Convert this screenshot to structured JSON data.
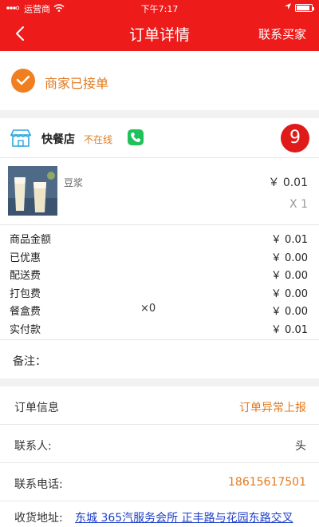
{
  "status_bar": {
    "carrier": "运营商",
    "time": "下午7:17",
    "battery_level": 0.9
  },
  "navbar": {
    "back_icon": "chevron-left-icon",
    "title": "订单详情",
    "contact_label": "联系买家"
  },
  "order_status": {
    "text": "商家已接单",
    "icon": "check-circle-icon",
    "color": "#f0801f"
  },
  "shop": {
    "name": "快餐店",
    "status": "不在线",
    "badge_count": "9"
  },
  "product": {
    "name": "豆浆",
    "price": "￥ 0.01",
    "quantity": "X 1"
  },
  "fees": [
    {
      "label": "商品金额",
      "mid": "",
      "value": "￥ 0.01"
    },
    {
      "label": "已优惠",
      "mid": "",
      "value": "￥ 0.00"
    },
    {
      "label": "配送费",
      "mid": "",
      "value": "￥ 0.00"
    },
    {
      "label": "打包费",
      "mid": "",
      "value": "￥ 0.00"
    },
    {
      "label": "餐盒费",
      "mid": "×0",
      "value": "￥ 0.00"
    },
    {
      "label": "实付款",
      "mid": "",
      "value": "￥ 0.01"
    }
  ],
  "remark": {
    "label": "备注："
  },
  "order_info": {
    "label": "订单信息",
    "report_link": "订单异常上报",
    "contact_label": "联系人:",
    "contact_value": "头",
    "phone_label": "联系电话:",
    "phone_value": "18615617501",
    "address_label": "收货地址:",
    "address_value": "东城 365汽服务会所 正丰路与花园东路交叉"
  },
  "colors": {
    "brand_red": "#ee1b1b",
    "accent_orange": "#e07a1f",
    "link_blue": "#1e3fc8",
    "phone_green": "#1fc15b"
  }
}
